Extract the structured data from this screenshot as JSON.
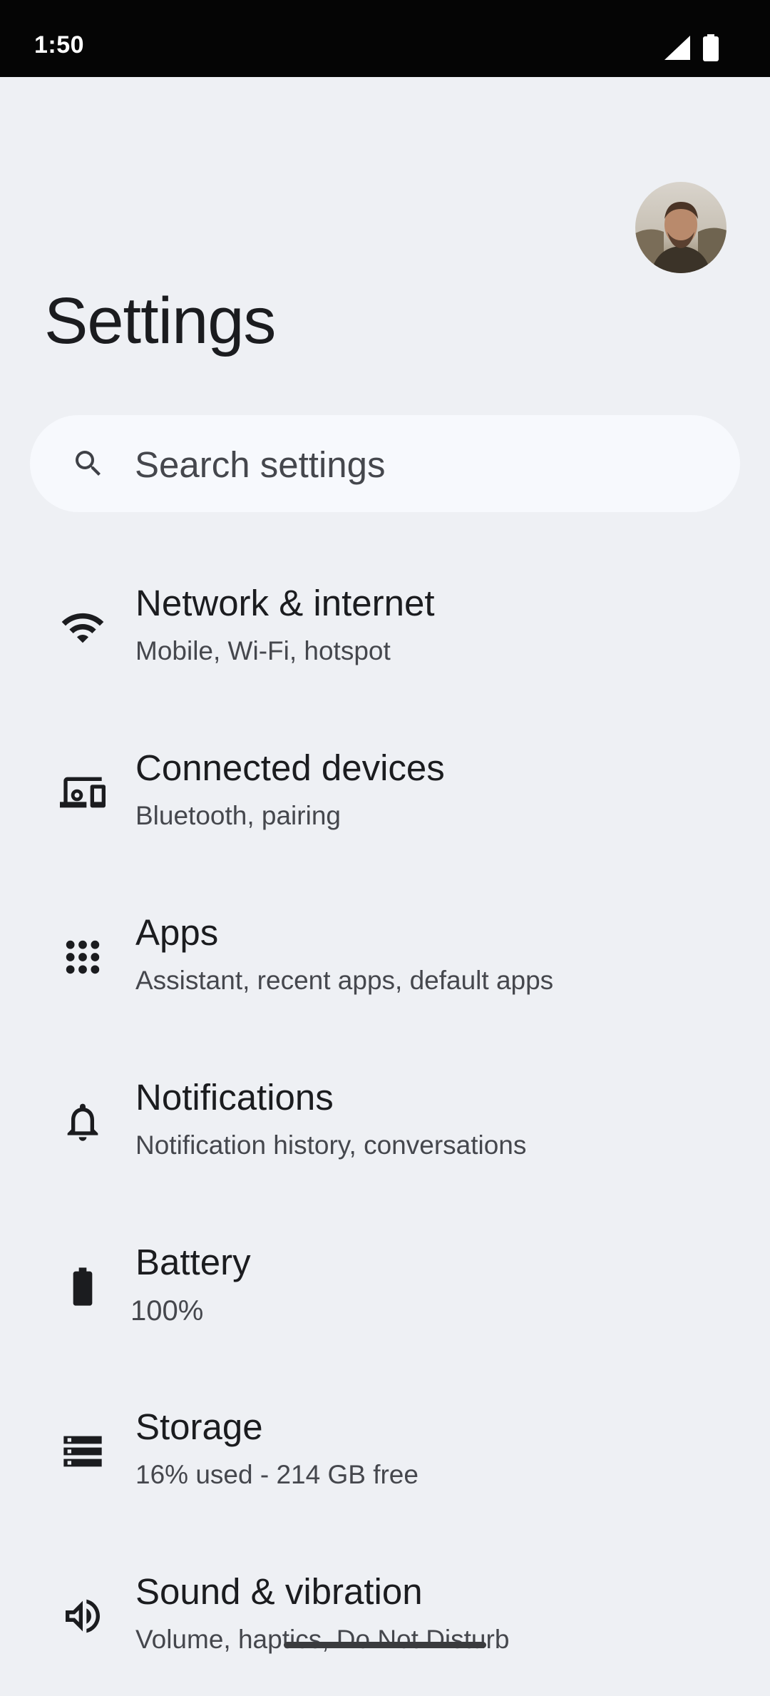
{
  "status_bar": {
    "time": "1:50"
  },
  "header": {
    "title": "Settings"
  },
  "search": {
    "placeholder": "Search settings"
  },
  "items": [
    {
      "title": "Network & internet",
      "subtitle": "Mobile, Wi-Fi, hotspot",
      "icon": "wifi-icon"
    },
    {
      "title": "Connected devices",
      "subtitle": "Bluetooth, pairing",
      "icon": "connected-devices-icon"
    },
    {
      "title": "Apps",
      "subtitle": "Assistant, recent apps, default apps",
      "icon": "apps-grid-icon"
    },
    {
      "title": "Notifications",
      "subtitle": "Notification history, conversations",
      "icon": "bell-icon"
    },
    {
      "title": "Battery",
      "subtitle": "100%",
      "icon": "battery-icon"
    },
    {
      "title": "Storage",
      "subtitle": "16% used - 214 GB free",
      "icon": "storage-icon"
    },
    {
      "title": "Sound & vibration",
      "subtitle": "Volume, haptics, Do Not Disturb",
      "icon": "volume-icon"
    }
  ],
  "colors": {
    "background": "#eef0f4",
    "search_background": "#f7f9fd",
    "status_bar": "#050505"
  }
}
